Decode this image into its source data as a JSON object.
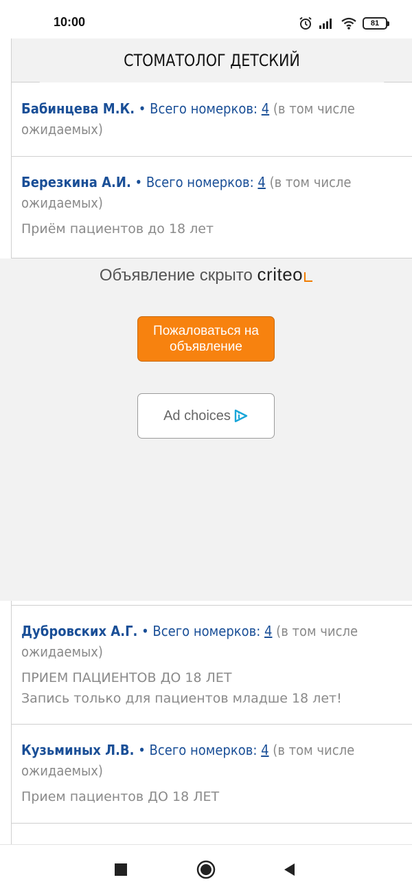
{
  "status_bar": {
    "time": "10:00",
    "battery": "81"
  },
  "section": {
    "title": "СТОМАТОЛОГ ДЕТСКИЙ"
  },
  "doctors": [
    {
      "name": "Бабинцева М.К.",
      "separator": " • ",
      "total_label": "Всего номерков: ",
      "count": "4",
      "suffix": " (в том числе ожидаемых)",
      "notes": []
    },
    {
      "name": "Березкина А.И.",
      "separator": " • ",
      "total_label": "Всего номерков: ",
      "count": "4",
      "suffix": " (в том числе ожидаемых)",
      "notes": [
        "Приём пациентов до 18 лет"
      ]
    },
    {
      "name": "Дубровских А.Г.",
      "separator": " • ",
      "total_label": "Всего номерков: ",
      "count": "4",
      "suffix": " (в том числе ожидаемых)",
      "notes": [
        "ПРИЕМ ПАЦИЕНТОВ ДО 18 ЛЕТ",
        "Запись только для пациентов младше 18 лет!"
      ]
    },
    {
      "name": "Кузьминых Л.В.",
      "separator": " • ",
      "total_label": "Всего номерков: ",
      "count": "4",
      "suffix": " (в том числе ожидаемых)",
      "notes": [
        "Прием пациентов ДО 18 ЛЕТ"
      ]
    }
  ],
  "ad": {
    "hidden_text": "Объявление скрыто",
    "brand": "criteo",
    "report_button": "Пожаловаться на объявление",
    "adchoices_button": "Ad choices"
  },
  "colors": {
    "link_blue": "#1a4f97",
    "muted_gray": "#8a8a8a",
    "report_orange": "#f7820f",
    "criteo_orange": "#f07c00"
  },
  "icons": {
    "status": [
      "alarm-icon",
      "signal-icon",
      "wifi-icon",
      "battery-icon"
    ],
    "nav": [
      "recents-square-icon",
      "home-circle-icon",
      "back-triangle-icon"
    ]
  }
}
